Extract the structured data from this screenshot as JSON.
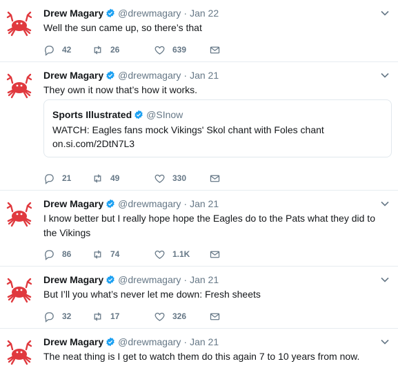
{
  "tweets": [
    {
      "name": "Drew Magary",
      "handle": "@drewmagary",
      "date": "Jan 22",
      "text": "Well the sun came up, so there’s that",
      "replies": "42",
      "retweets": "26",
      "likes": "639"
    },
    {
      "name": "Drew Magary",
      "handle": "@drewmagary",
      "date": "Jan 21",
      "text": "They own it now that’s how it works.",
      "replies": "21",
      "retweets": "49",
      "likes": "330",
      "quote": {
        "name": "Sports Illustrated",
        "handle": "@SInow",
        "line1": "WATCH: Eagles fans mock Vikings' Skol chant with Foles chant",
        "line2": "on.si.com/2DtN7L3"
      }
    },
    {
      "name": "Drew Magary",
      "handle": "@drewmagary",
      "date": "Jan 21",
      "text": "I know better but I really hope hope the Eagles do to the Pats what they did to the Vikings",
      "replies": "86",
      "retweets": "74",
      "likes": "1.1K"
    },
    {
      "name": "Drew Magary",
      "handle": "@drewmagary",
      "date": "Jan 21",
      "text": "But I’ll you what’s never let me down: Fresh sheets",
      "replies": "32",
      "retweets": "17",
      "likes": "326"
    },
    {
      "name": "Drew Magary",
      "handle": "@drewmagary",
      "date": "Jan 21",
      "text": "The neat thing is I get to watch them do this again 7 to 10 years from now."
    }
  ],
  "separator": "·",
  "icons": {
    "avatar": "crab-avatar",
    "verified": "verified-badge-icon",
    "caret": "chevron-down-icon",
    "reply": "reply-icon",
    "retweet": "retweet-icon",
    "like": "heart-icon",
    "dm": "envelope-icon"
  },
  "colors": {
    "verified": "#1da1f2",
    "crab": "#e0393e",
    "muted": "#657786",
    "divider": "#e6ecf0"
  }
}
